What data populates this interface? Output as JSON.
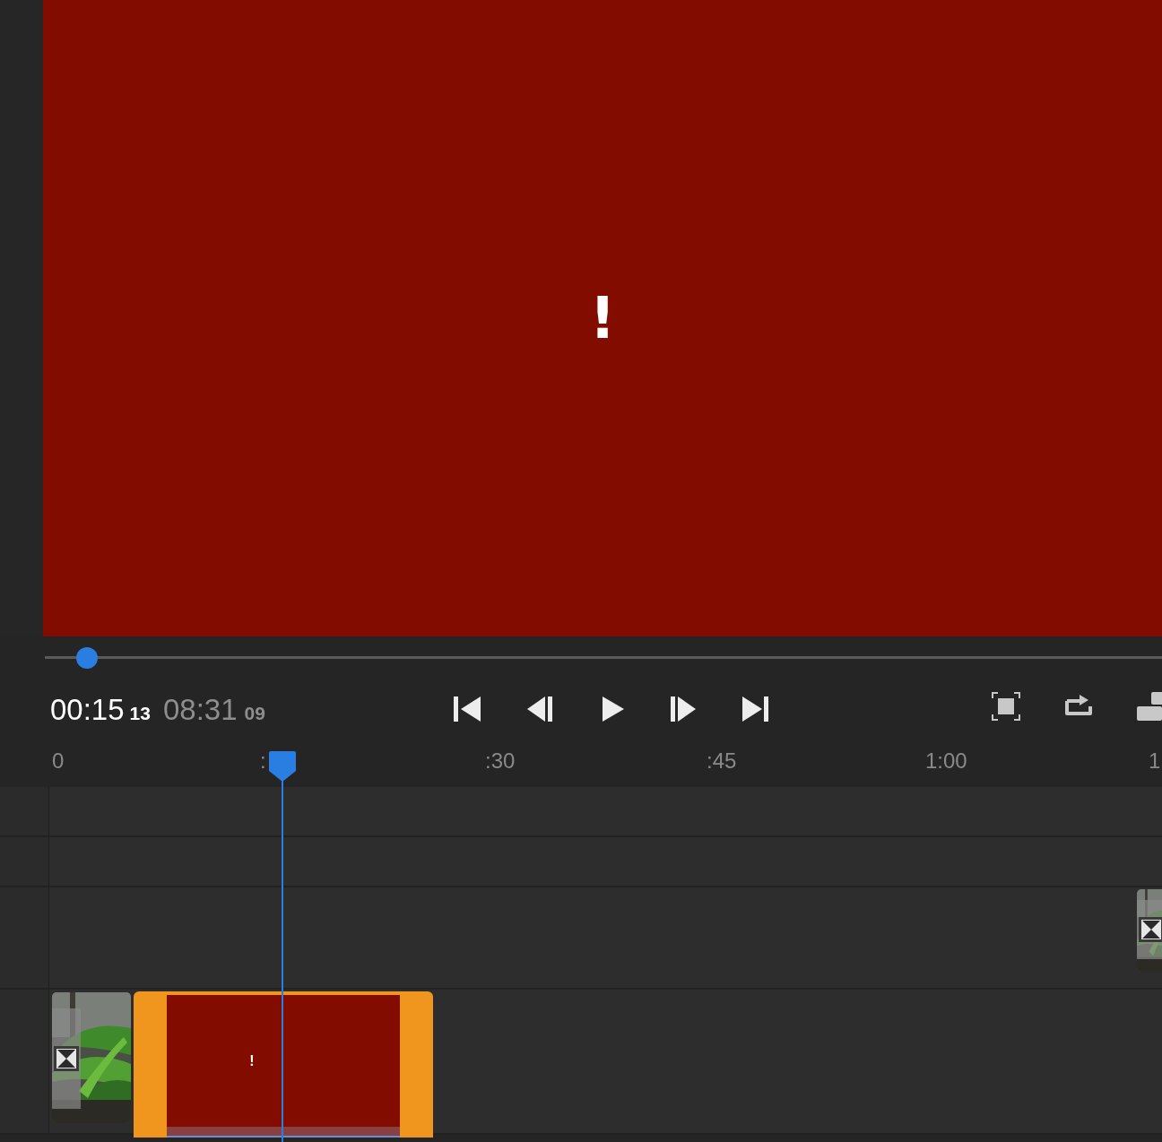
{
  "preview": {
    "kind": "error",
    "mark": "!"
  },
  "scrubber": {
    "level": 0.038
  },
  "timecode": {
    "current": "00:15",
    "current_frames": "13",
    "duration": "08:31",
    "duration_frames": "09"
  },
  "transport": [
    {
      "kind": "start"
    },
    {
      "kind": "back"
    },
    {
      "kind": "play"
    },
    {
      "kind": "forward"
    },
    {
      "kind": "end"
    }
  ],
  "tools": [
    {
      "kind": "fit"
    },
    {
      "kind": "share"
    },
    {
      "kind": "layout"
    }
  ],
  "ruler": [
    "0",
    ":",
    ":30",
    ":45",
    "1:00",
    "1"
  ],
  "tracks": [
    {
      "kind": "video"
    },
    {
      "kind": "video"
    },
    {
      "kind": "video",
      "clips": [
        {
          "kind": "picture",
          "selected": false
        }
      ]
    },
    {
      "kind": "video",
      "clips": [
        {
          "kind": "picture",
          "selected": false
        },
        {
          "kind": "error",
          "selected": true,
          "mark": "!"
        }
      ]
    }
  ]
}
